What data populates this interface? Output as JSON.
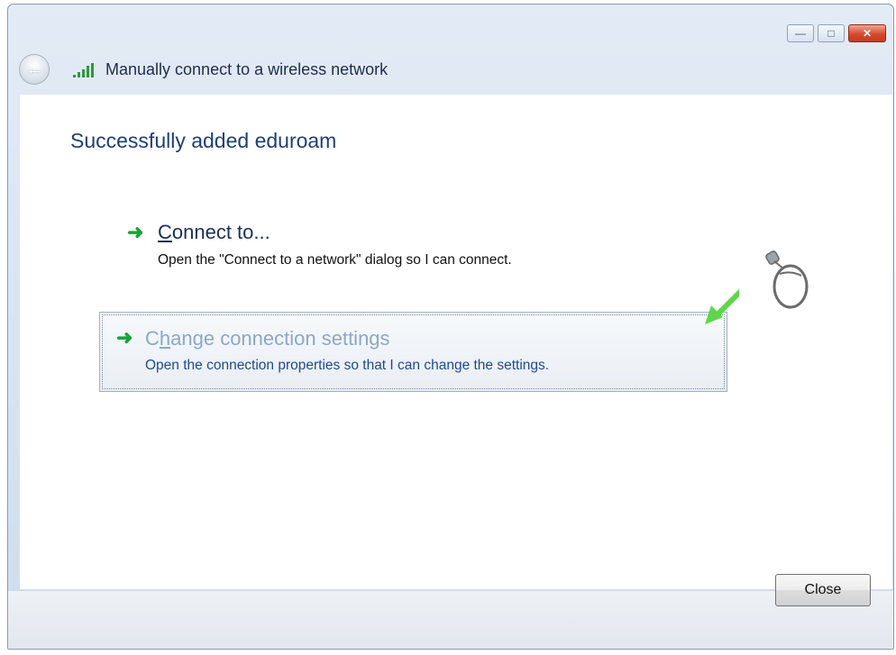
{
  "window": {
    "title": "Manually connect to a wireless network",
    "controls": {
      "minimize": "—",
      "maximize": "□",
      "close": "✕"
    }
  },
  "content": {
    "heading": "Successfully added eduroam",
    "options": [
      {
        "title_accel": "C",
        "title_rest": "onnect to...",
        "description": "Open the \"Connect to a network\" dialog so I can connect."
      },
      {
        "title_pre": "C",
        "title_accel": "h",
        "title_rest": "ange connection settings",
        "description": "Open the connection properties so that I can change the settings."
      }
    ]
  },
  "footer": {
    "close_label": "Close"
  },
  "icons": {
    "back": "back-arrow-icon",
    "wifi": "wireless-signal-icon",
    "option_arrow": "green-arrow-icon",
    "pointer": "green-pointer-arrow-icon",
    "mouse": "mouse-icon"
  },
  "colors": {
    "accent_green": "#17a33a",
    "heading_blue": "#1f3f74",
    "link_blue": "#1f4a8e"
  }
}
